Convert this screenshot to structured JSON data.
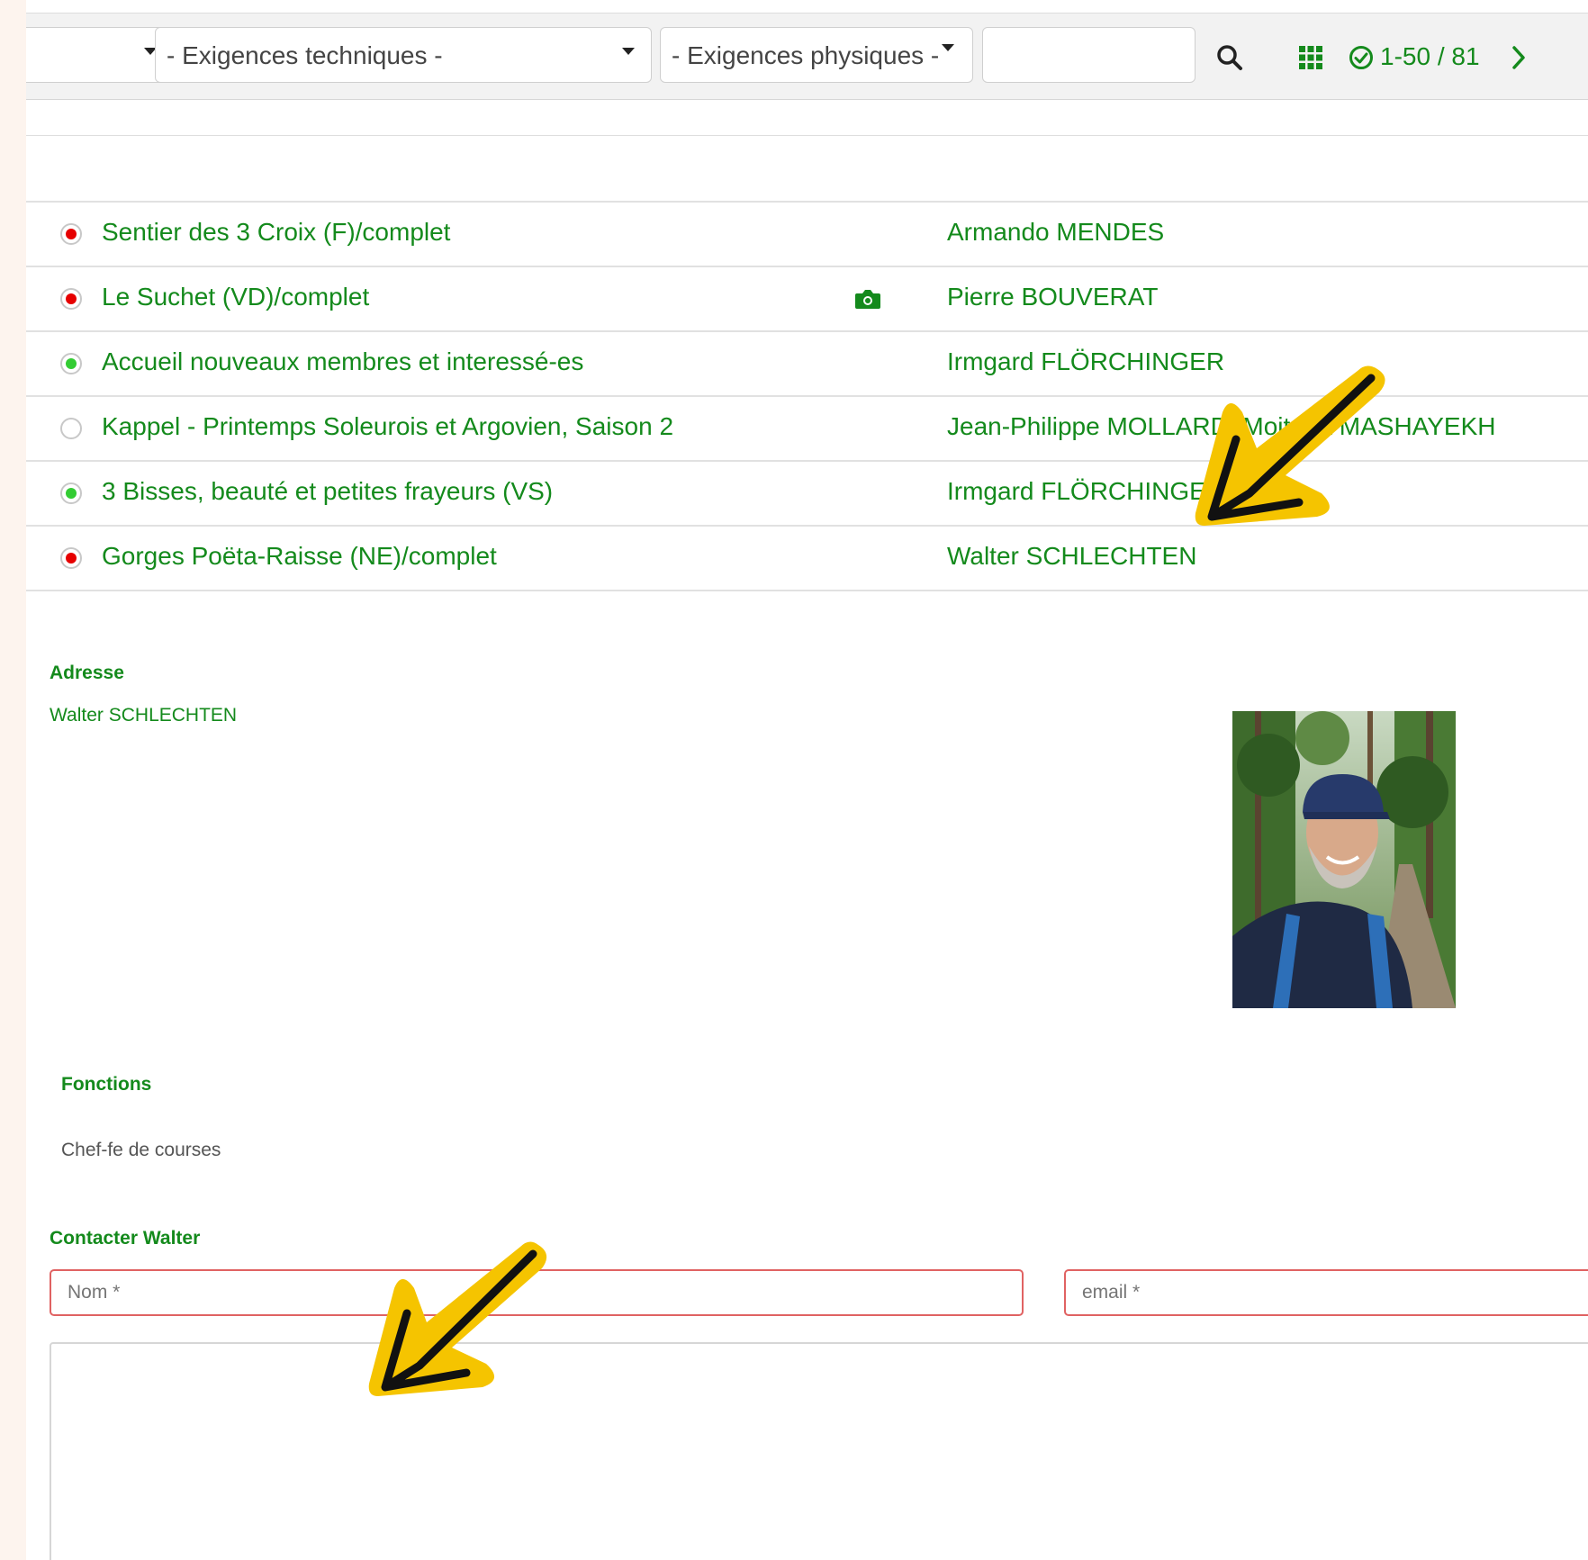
{
  "filters": {
    "select_empty_label": "",
    "technical_label": "- Exigences techniques -",
    "physical_label": "- Exigences physiques -",
    "search_value": "",
    "pagination": "1-50 / 81"
  },
  "colors": {
    "accent": "#148a1c",
    "status_red": "#e60000",
    "status_green": "#33cc33",
    "error_border": "#e06262"
  },
  "rows": [
    {
      "title": "Sentier des 3 Croix (F)/complet",
      "leader": "Armando MENDES",
      "status": "red"
    },
    {
      "title": "Le Suchet (VD)/complet",
      "leader": "Pierre BOUVERAT",
      "status": "red",
      "icon": "camera-icon"
    },
    {
      "title": "Accueil nouveaux membres et interessé-es",
      "leader": "Irmgard FLÖRCHINGER",
      "status": "green"
    },
    {
      "title": "Kappel - Printemps Soleurois et Argovien, Saison 2",
      "leader": "Jean-Philippe MOLLARD, Mojtaba MASHAYEKH",
      "status": "empty"
    },
    {
      "title": "3 Bisses, beauté et petites frayeurs (VS)",
      "leader": "Irmgard FLÖRCHINGER",
      "status": "green"
    },
    {
      "title": "Gorges Poëta-Raisse (NE)/complet",
      "leader": "Walter SCHLECHTEN",
      "status": "red"
    }
  ],
  "profile": {
    "address_label": "Adresse",
    "name": "Walter SCHLECHTEN",
    "functions_label": "Fonctions",
    "function": "Chef-fe de courses",
    "contact_label": "Contacter Walter"
  },
  "form": {
    "name_placeholder": "Nom *",
    "email_placeholder": "email *",
    "message_value": ""
  }
}
